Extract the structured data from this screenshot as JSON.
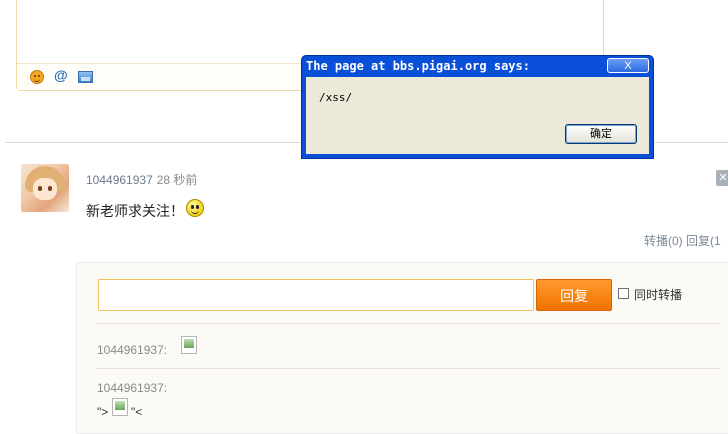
{
  "composer": {
    "toolbar": [
      "smiley-icon",
      "at-icon",
      "image-icon"
    ],
    "at_label": "@"
  },
  "post": {
    "author": "1044961937",
    "time": "28 秒前",
    "text": "新老师求关注！",
    "delete_label": "✕",
    "repost_label": "转播(0)",
    "reply_label": "回复(1"
  },
  "reply": {
    "input_value": "",
    "button_label": "回复",
    "sync_label": "同时转播",
    "comments": [
      {
        "user": "1044961937:"
      },
      {
        "user": "1044961937:",
        "text_before": "\">",
        "text_after": "\"<"
      }
    ]
  },
  "dialog": {
    "title": "The page at bbs.pigai.org says:",
    "close_label": "X",
    "message": "/xss/",
    "ok_label": "确定"
  },
  "colors": {
    "accent_orange": "#f07300",
    "dialog_blue": "#0a4fd8",
    "link_gray": "#6c7a8c"
  }
}
